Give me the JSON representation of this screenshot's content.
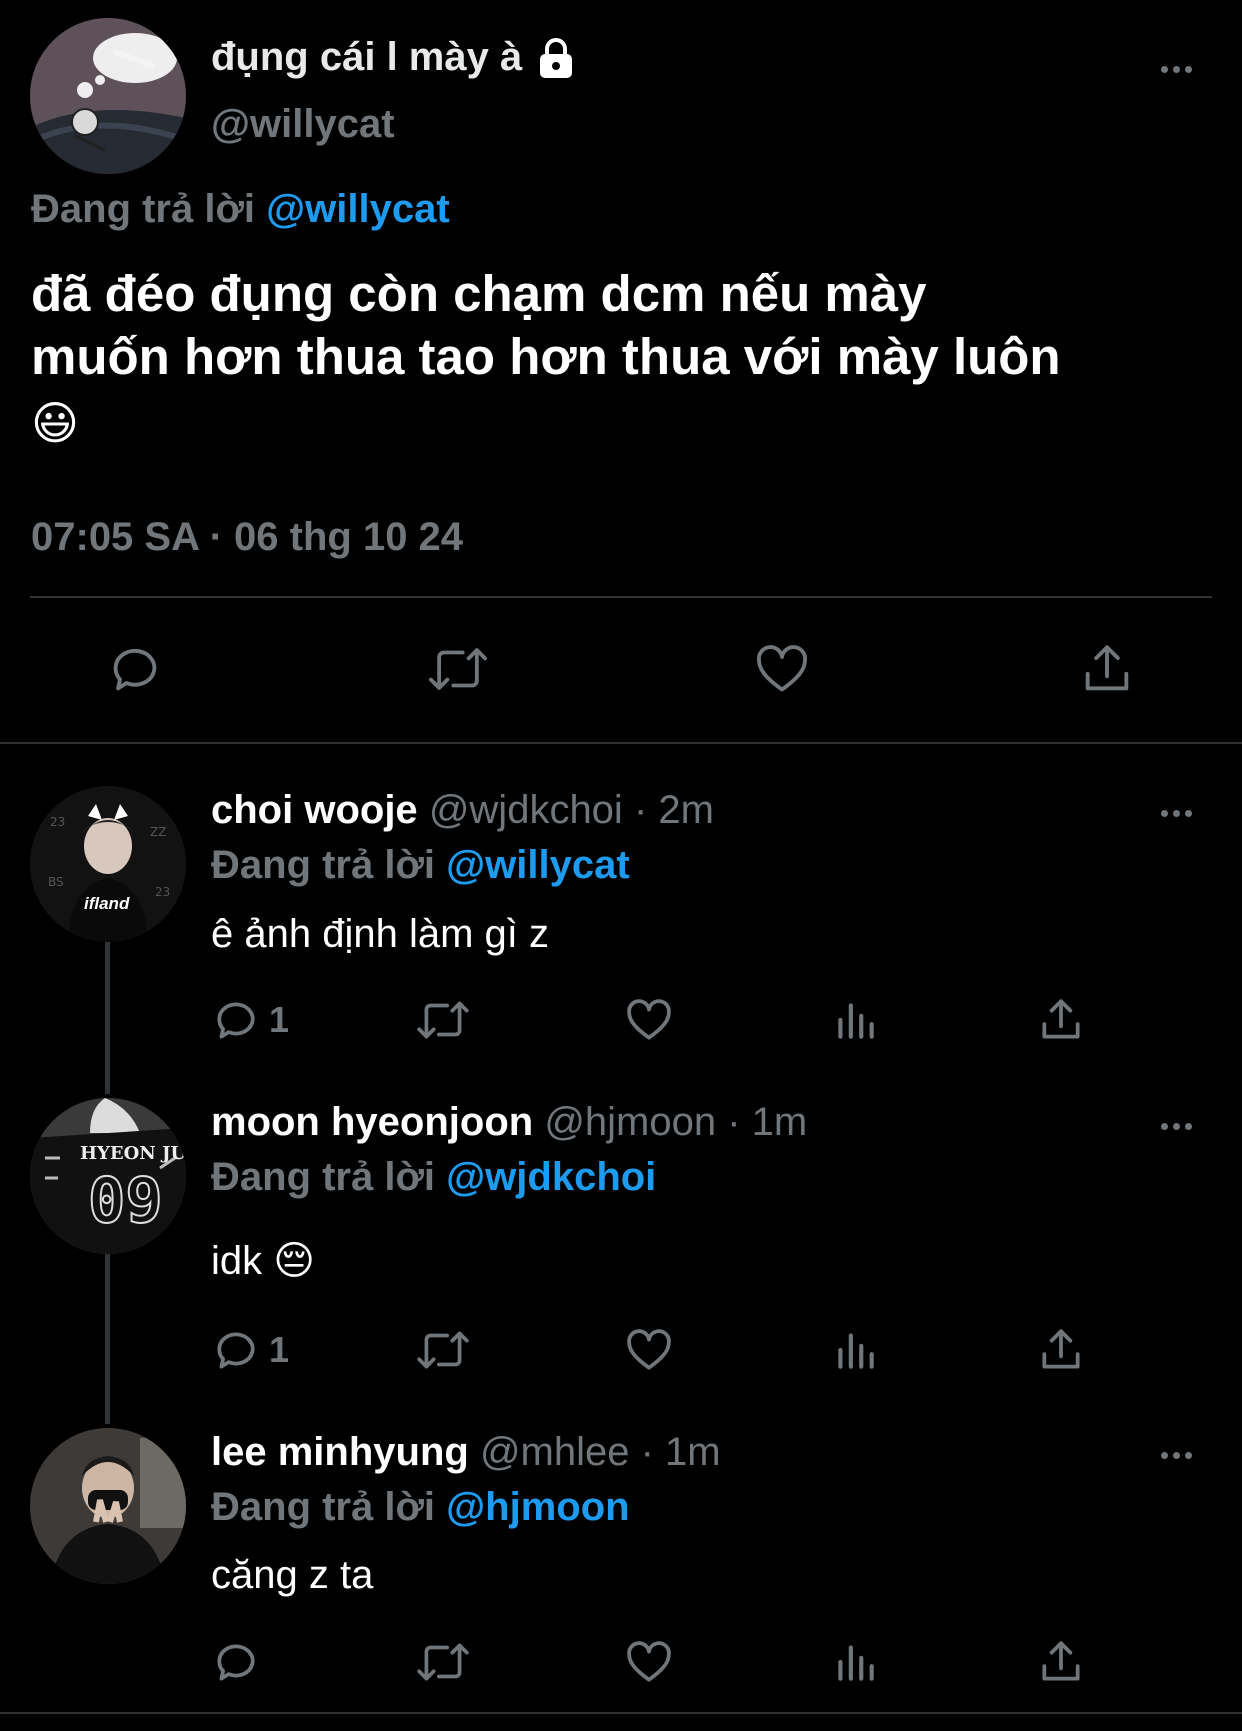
{
  "main_tweet": {
    "display_name": "đụng cái l mày à",
    "handle": "@willycat",
    "replying_prefix": "Đang trả lời",
    "replying_to": "@willycat",
    "text_line1": "đã đéo đụng còn chạm dcm nếu mày",
    "text_line2": "muốn hơn thua tao hơn thua với mày luôn",
    "emoji": "😃",
    "timestamp": "07:05 SA · 06 thg 10 24"
  },
  "replies": [
    {
      "name": "choi wooje",
      "handle": "@wjdkchoi",
      "time": "· 2m",
      "replying_prefix": "Đang trả lời",
      "replying_to": "@willycat",
      "text": "ê ảnh định làm gì z",
      "reply_count": "1",
      "avatar_text": "ifland"
    },
    {
      "name": "moon hyeonjoon",
      "handle": "@hjmoon",
      "time": "· 1m",
      "replying_prefix": "Đang trả lời",
      "replying_to": "@wjdkchoi",
      "text": "idk 😔",
      "reply_count": "1",
      "avatar_name": "HYEON JUN",
      "avatar_number": "09"
    },
    {
      "name": "lee minhyung",
      "handle": "@mhlee",
      "time": "· 1m",
      "replying_prefix": "Đang trả lời",
      "replying_to": "@hjmoon",
      "text": "căng z ta",
      "reply_count": ""
    }
  ],
  "icons": {
    "lock": "lock-icon",
    "more": "more-icon",
    "reply": "reply-icon",
    "retweet": "retweet-icon",
    "like": "like-icon",
    "views": "views-icon",
    "share": "share-icon"
  },
  "colors": {
    "background": "#000000",
    "text": "#e7e9ea",
    "muted": "#71767b",
    "link": "#1d9bf0",
    "divider": "#2f3336"
  }
}
